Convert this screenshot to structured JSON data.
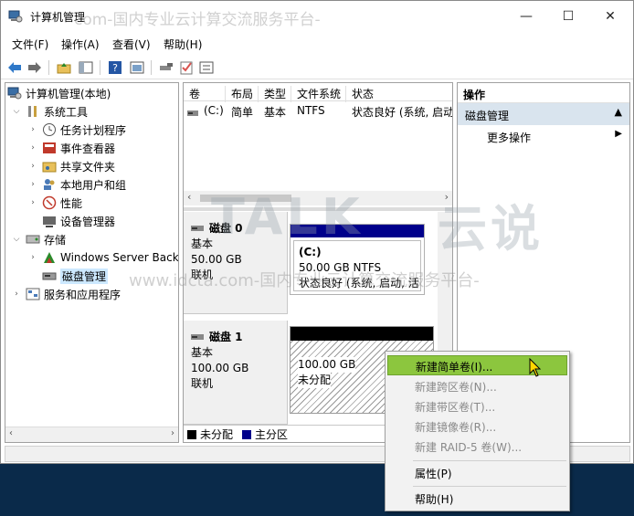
{
  "window": {
    "title": "计算机管理",
    "minimize_glyph": "—",
    "maximize_glyph": "☐",
    "close_glyph": "✕"
  },
  "menu": [
    "文件(F)",
    "操作(A)",
    "查看(V)",
    "帮助(H)"
  ],
  "toolbar_icons": [
    "back-arrow-icon",
    "forward-arrow-icon",
    "folder-up-icon",
    "console-tree-icon",
    "help-icon",
    "properties-icon",
    "connect-icon",
    "check-icon",
    "list-icon"
  ],
  "tree": {
    "root": "计算机管理(本地)",
    "system_tools": "系统工具",
    "task_scheduler": "任务计划程序",
    "event_viewer": "事件查看器",
    "shared_folders": "共享文件夹",
    "local_users": "本地用户和组",
    "performance": "性能",
    "device_manager": "设备管理器",
    "storage": "存储",
    "windows_server_backup": "Windows Server Back",
    "disk_management": "磁盘管理",
    "services_apps": "服务和应用程序"
  },
  "volume_list": {
    "headers": [
      "卷",
      "布局",
      "类型",
      "文件系统",
      "状态"
    ],
    "rows": [
      {
        "volume": "(C:)",
        "layout": "简单",
        "type": "基本",
        "fs": "NTFS",
        "status": "状态良好 (系统, 启动"
      }
    ]
  },
  "disks": [
    {
      "name": "磁盘 0",
      "type": "基本",
      "size": "50.00 GB",
      "state": "联机",
      "partition": {
        "label": "(C:)",
        "size_fs": "50.00 GB NTFS",
        "status": "状态良好 (系统, 启动, 活"
      }
    },
    {
      "name": "磁盘 1",
      "type": "基本",
      "size": "100.00 GB",
      "state": "联机",
      "partition": {
        "size": "100.00 GB",
        "status": "未分配"
      }
    }
  ],
  "legend": {
    "unallocated": "未分配",
    "primary": "主分区"
  },
  "colors": {
    "primary": "#00008b",
    "unallocated": "#000000",
    "menu_highlight": "#8cc63e",
    "actions_sub_bg": "#d9e4ee"
  },
  "actions": {
    "header": "操作",
    "section": "磁盘管理",
    "more": "更多操作"
  },
  "context_menu": {
    "new_simple": "新建简单卷(I)...",
    "new_spanned": "新建跨区卷(N)...",
    "new_striped": "新建带区卷(T)...",
    "new_mirrored": "新建镜像卷(R)...",
    "new_raid5": "新建 RAID-5 卷(W)...",
    "properties": "属性(P)",
    "help": "帮助(H)"
  },
  "watermarks": {
    "top": "com-国内专业云计算交流服务平台-",
    "middle": "www.idcta.com-国内专业云计算交流服务平台-",
    "logo_talk": "TALK",
    "logo_cn": "云说"
  }
}
